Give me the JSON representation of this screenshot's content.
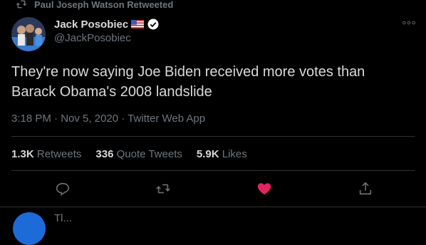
{
  "retweet": {
    "label": "Paul Joseph Watson Retweeted"
  },
  "author": {
    "name": "Jack Posobiec",
    "handle": "@JackPosobiec",
    "flag_icon": "us-flag-icon",
    "verified_icon": "verified-badge-icon"
  },
  "tweet": {
    "text_line1": "They're now saying Joe Biden received more votes than",
    "text_line2": "Barack Obama's 2008 landslide",
    "time": "3:18 PM",
    "date": "Nov 5, 2020",
    "source": "Twitter Web App",
    "separator": " · "
  },
  "stats": {
    "retweets_count": "1.3K",
    "retweets_label": "Retweets",
    "quotes_count": "336",
    "quotes_label": "Quote Tweets",
    "likes_count": "5.9K",
    "likes_label": "Likes"
  },
  "actions": {
    "reply_icon": "reply-icon",
    "retweet_icon": "retweet-icon",
    "like_icon": "heart-icon",
    "share_icon": "share-icon",
    "like_color": "#e0245e"
  },
  "next_tweet": {
    "partial": "Tl..."
  },
  "colors": {
    "background": "#000000",
    "text": "#d9d9d9",
    "muted": "#6e767d",
    "divider": "#2f3336"
  }
}
